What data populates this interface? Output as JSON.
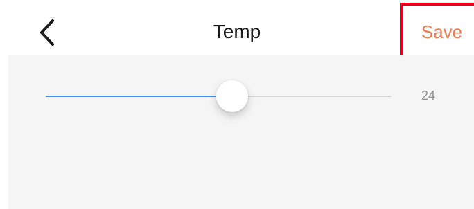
{
  "header": {
    "back_icon": "chevron-left-icon",
    "title": "Temp",
    "save_label": "Save"
  },
  "colors": {
    "accent": "#ef7a4f",
    "highlight_box": "#e8001d",
    "slider_fill": "#3a8ee6",
    "slider_track": "#d3d3d3",
    "content_bg": "#f5f5f5"
  },
  "slider": {
    "value": "24",
    "fill_fraction": 0.54
  }
}
